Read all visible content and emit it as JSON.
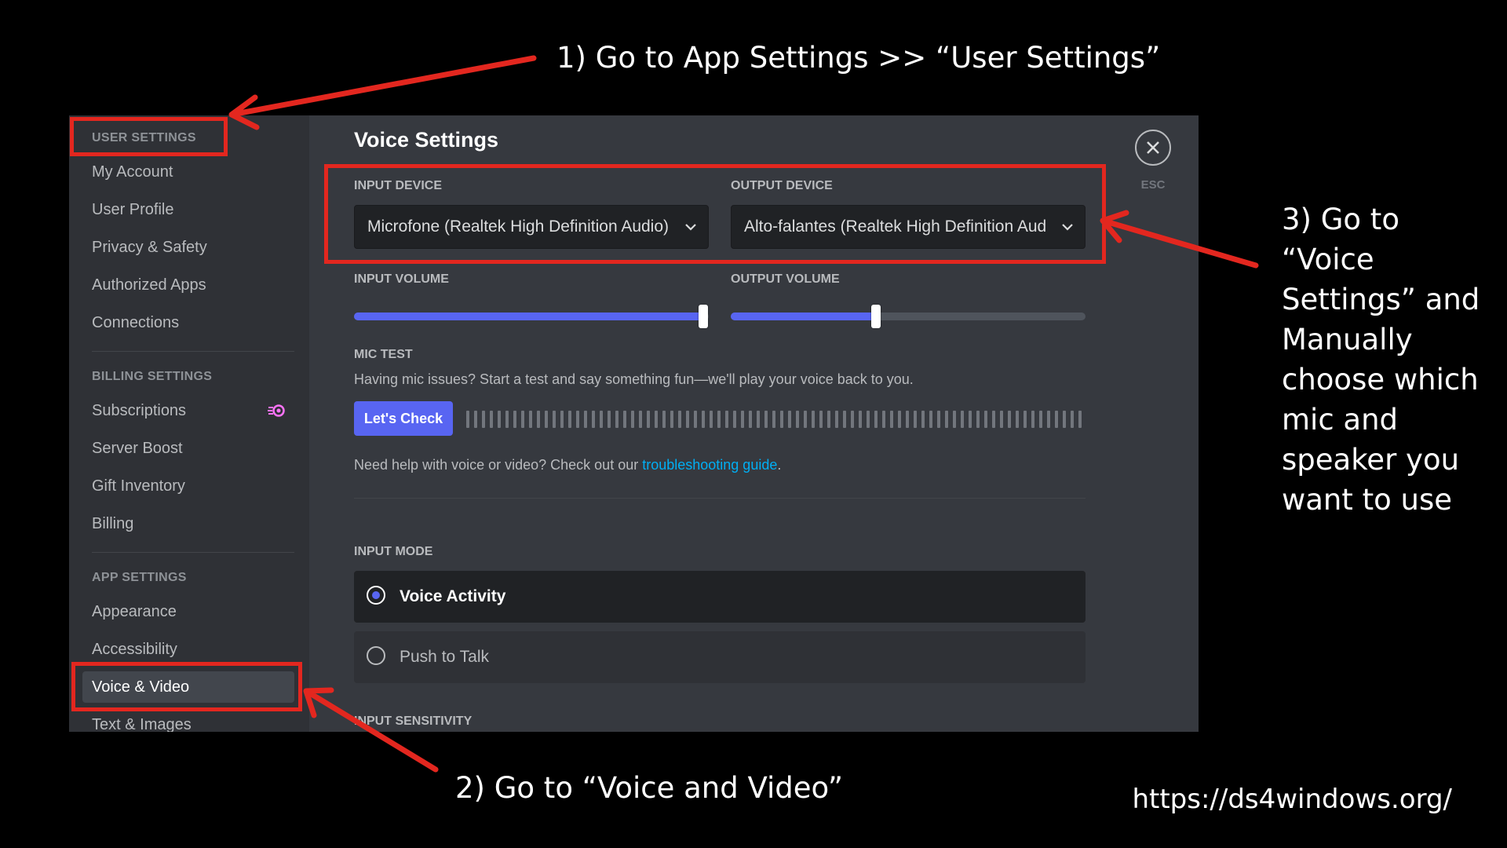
{
  "annotations": {
    "step1": "1) Go to App Settings >> “User Settings”",
    "step2": "2) Go to “Voice and Video”",
    "step3": "3) Go to “Voice Settings” and Manually choose which mic and speaker you want to use",
    "url": "https://ds4windows.org/"
  },
  "sidebar": {
    "sections": [
      {
        "header": "User Settings",
        "items": [
          "My Account",
          "User Profile",
          "Privacy & Safety",
          "Authorized Apps",
          "Connections"
        ]
      },
      {
        "header": "Billing Settings",
        "items": [
          "Subscriptions",
          "Server Boost",
          "Gift Inventory",
          "Billing"
        ]
      },
      {
        "header": "App Settings",
        "items": [
          "Appearance",
          "Accessibility",
          "Voice & Video",
          "Text & Images"
        ]
      }
    ],
    "active_item": "Voice & Video"
  },
  "main": {
    "title": "Voice Settings",
    "input_device": {
      "label": "Input Device",
      "value": "Microfone (Realtek High Definition Audio)"
    },
    "output_device": {
      "label": "Output Device",
      "value": "Alto-falantes (Realtek High Definition Aud"
    },
    "input_volume": {
      "label": "Input Volume",
      "level": 0.985
    },
    "output_volume": {
      "label": "Output Volume",
      "level": 0.41
    },
    "mic_test": {
      "label": "Mic Test",
      "description": "Having mic issues? Start a test and say something fun—we'll play your voice back to you.",
      "button": "Let's Check"
    },
    "help": {
      "prefix": "Need help with voice or video? Check out our ",
      "link": "troubleshooting guide",
      "suffix": "."
    },
    "input_mode": {
      "label": "Input Mode",
      "options": [
        "Voice Activity",
        "Push to Talk"
      ],
      "selected": "Voice Activity"
    },
    "input_sensitivity": {
      "label": "Input Sensitivity"
    },
    "close": {
      "esc_label": "ESC"
    }
  },
  "colors": {
    "accent": "#5865f2",
    "highlight_red": "#e3271f",
    "link": "#00aff4"
  },
  "icons": [
    "close-icon",
    "chevron-down-icon",
    "boost-icon",
    "radio-selected-icon",
    "radio-unselected-icon"
  ]
}
